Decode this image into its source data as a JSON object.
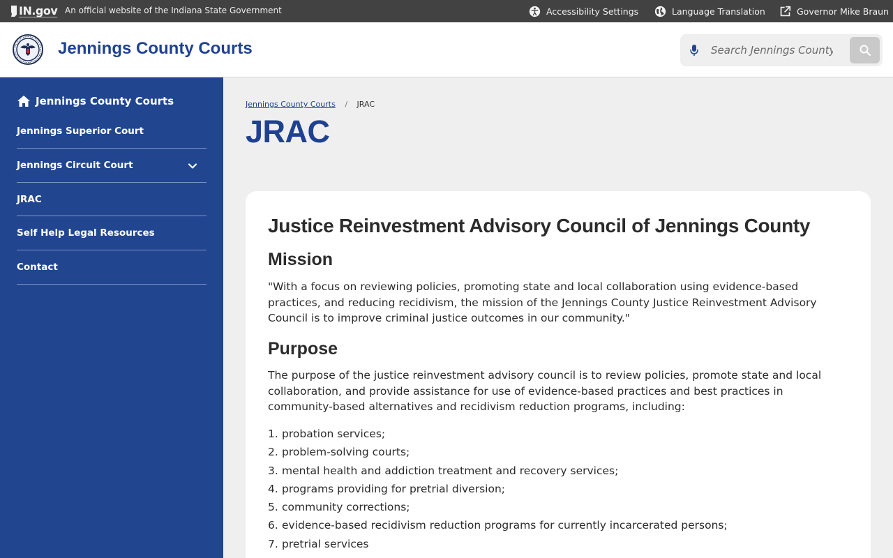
{
  "utility_bar": {
    "logo_text": "IN.gov",
    "official_text": "An official website of the Indiana State Government",
    "links": [
      {
        "label": "Accessibility Settings",
        "icon": "accessibility-icon"
      },
      {
        "label": "Language Translation",
        "icon": "globe-icon"
      },
      {
        "label": "Governor Mike Braun",
        "icon": "external-link-icon"
      }
    ]
  },
  "header": {
    "seal_icon": "county-seal-icon",
    "title": "Jennings County Courts",
    "search": {
      "placeholder": "Search Jennings County",
      "value": ""
    }
  },
  "sidebar": {
    "home_label": "Jennings County Courts",
    "items": [
      {
        "label": "Jennings Superior Court",
        "has_submenu": false
      },
      {
        "label": "Jennings Circuit Court",
        "has_submenu": true
      },
      {
        "label": "JRAC",
        "has_submenu": false
      },
      {
        "label": "Self Help Legal Resources",
        "has_submenu": false
      },
      {
        "label": "Contact",
        "has_submenu": false
      }
    ]
  },
  "breadcrumb": {
    "home": "Jennings County Courts",
    "separator": "/",
    "current": "JRAC"
  },
  "page": {
    "title": "JRAC",
    "heading": "Justice Reinvestment Advisory Council of Jennings County",
    "mission_heading": "Mission",
    "mission_text": "\"With a focus on reviewing policies, promoting state and local collaboration using evidence-based practices, and reducing recidivism, the mission of the Jennings County Justice Reinvestment Advisory Council is to improve criminal justice outcomes in our community.\"",
    "purpose_heading": "Purpose",
    "purpose_text": "The purpose of the justice reinvestment advisory council is to review policies, promote state and local collaboration, and provide assistance for use of evidence-based practices and best practices in community-based alternatives and recidivism reduction programs, including:",
    "purpose_list": [
      {
        "num": "1.",
        "text": "probation services;"
      },
      {
        "num": "2.",
        "text": "problem-solving courts;"
      },
      {
        "num": "3.",
        "text": "mental health and addiction treatment and recovery services;"
      },
      {
        "num": "4.",
        "text": "programs providing for pretrial diversion;"
      },
      {
        "num": "5.",
        "text": "community corrections;"
      },
      {
        "num": "6.",
        "text": "evidence-based recidivism reduction programs for currently incarcerated persons;"
      },
      {
        "num": "7.",
        "text": "pretrial services"
      }
    ]
  },
  "colors": {
    "brand_blue": "#1f4191",
    "sidebar_blue": "#21468f",
    "utility_bar": "#424242"
  }
}
